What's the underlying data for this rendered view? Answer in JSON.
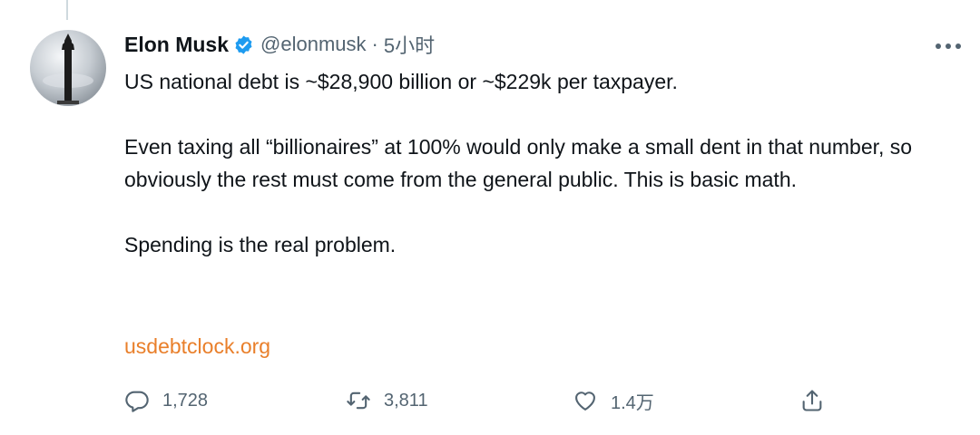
{
  "tweet": {
    "author": {
      "display_name": "Elon Musk",
      "handle": "@elonmusk",
      "verified": true
    },
    "separator": "·",
    "timestamp": "5小时",
    "paragraphs": [
      "US national debt is ~$28,900 billion or ~$229k per taxpayer.",
      "Even taxing all “billionaires” at 100% would only make a small dent in that number, so obviously the rest must come from the general public. This is basic math.",
      "Spending is the real problem."
    ],
    "link": "usdebtclock.org",
    "actions": {
      "reply_count": "1,728",
      "retweet_count": "3,811",
      "like_count": "1.4万",
      "share_icon": "share-icon"
    }
  },
  "colors": {
    "text": "#0f1419",
    "secondary_text": "#536471",
    "link": "#e97f2a",
    "verified": "#1d9bf0"
  }
}
